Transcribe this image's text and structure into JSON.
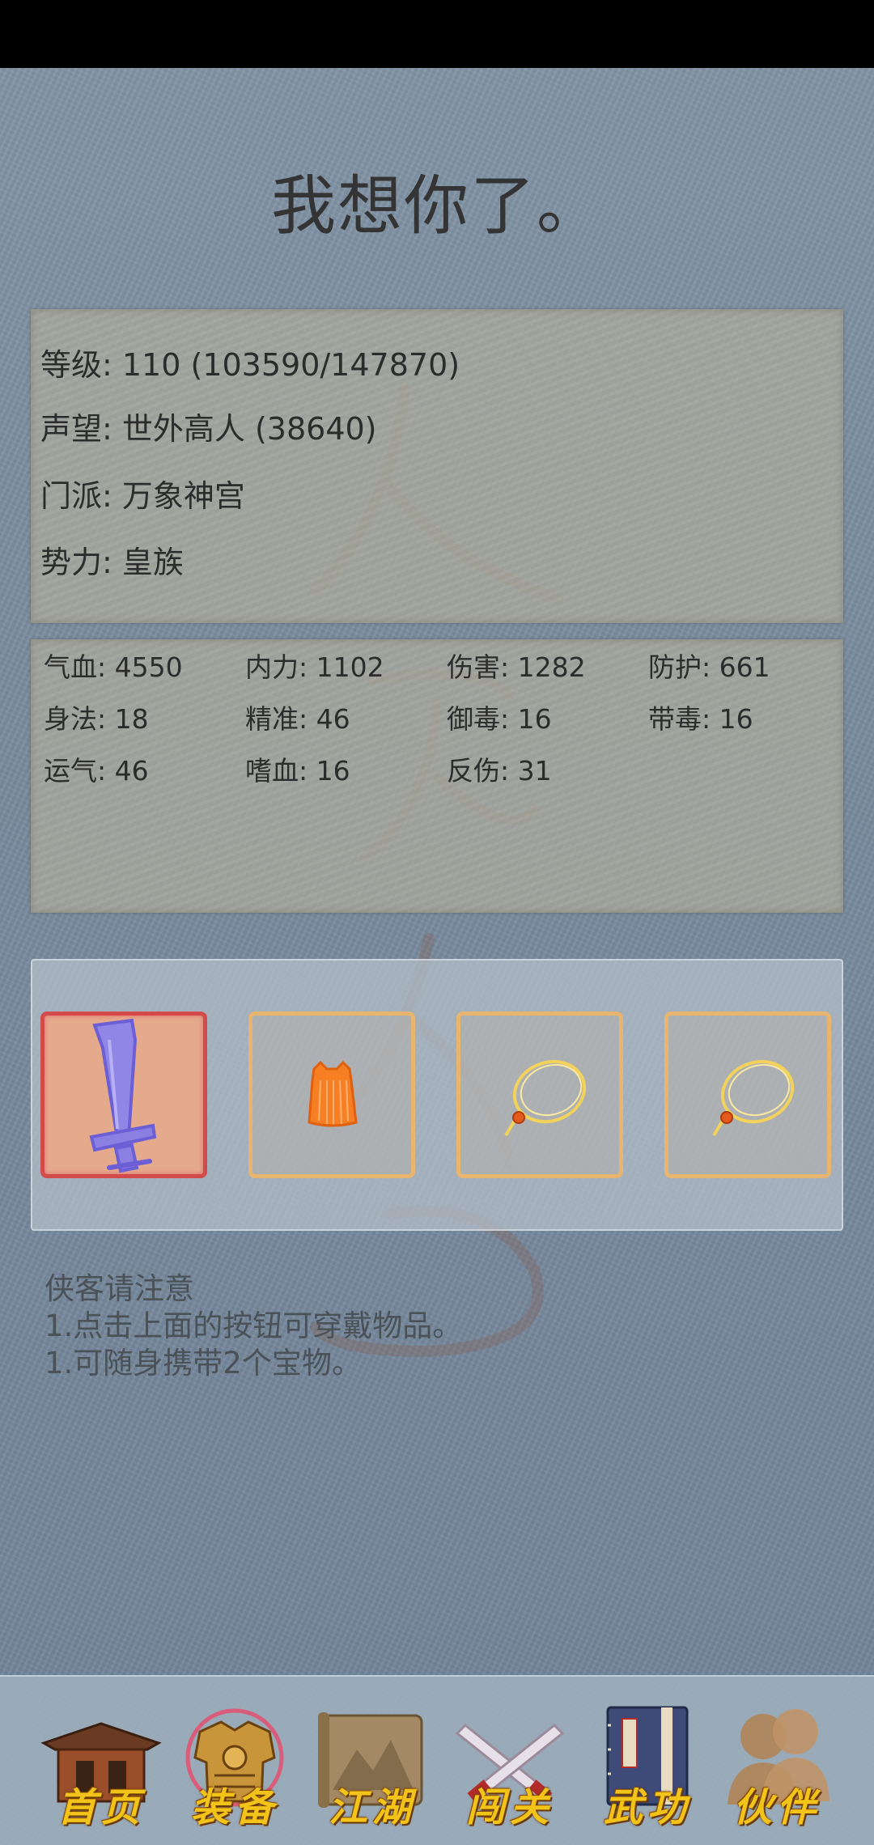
{
  "title": "我想你了。",
  "info": {
    "level": "等级: 110 (103590/147870)",
    "reputation": "声望: 世外高人 (38640)",
    "sect": "门派: 万象神宫",
    "faction": "势力:  皇族"
  },
  "stats": [
    [
      "气血: 4550",
      "内力: 1102",
      "伤害: 1282",
      "防护: 661"
    ],
    [
      "身法: 18",
      "精准: 46",
      "御毒: 16",
      "带毒: 16"
    ],
    [
      "运气: 46",
      "嗜血: 16",
      "反伤: 31",
      ""
    ]
  ],
  "equipment": [
    {
      "icon": "sword-icon",
      "selected": true
    },
    {
      "icon": "robe-icon",
      "selected": false
    },
    {
      "icon": "necklace-icon",
      "selected": false
    },
    {
      "icon": "necklace-icon",
      "selected": false
    }
  ],
  "notice": [
    "侠客请注意",
    "1.点击上面的按钮可穿戴物品。",
    "1.可随身携带2个宝物。"
  ],
  "nav": [
    {
      "label": "首页",
      "icon": "home-temple-icon"
    },
    {
      "label": "装备",
      "icon": "armor-icon",
      "active": true
    },
    {
      "label": "江湖",
      "icon": "scroll-map-icon"
    },
    {
      "label": "闯关",
      "icon": "crossed-swords-icon"
    },
    {
      "label": "武功",
      "icon": "book-icon"
    },
    {
      "label": "伙伴",
      "icon": "companions-icon"
    }
  ],
  "colors": {
    "background": "#7b8c9e",
    "slot_border": "#e8b56e",
    "slot_selected_border": "#d24a4a",
    "nav_label": "#f2c419"
  }
}
